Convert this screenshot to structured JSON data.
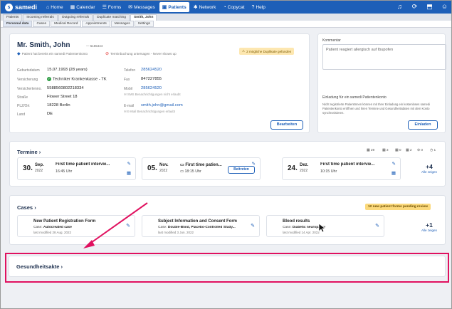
{
  "brand": {
    "name": "samedi"
  },
  "nav": [
    {
      "label": "Home",
      "icon": "home-icon",
      "glyph": "⌂"
    },
    {
      "label": "Calendar",
      "icon": "calendar-icon",
      "glyph": "▦"
    },
    {
      "label": "Forms",
      "icon": "forms-icon",
      "glyph": "☰"
    },
    {
      "label": "Messages",
      "icon": "messages-icon",
      "glyph": "✉"
    },
    {
      "label": "Patients",
      "icon": "patients-icon",
      "glyph": "▣",
      "active": true
    },
    {
      "label": "Network",
      "icon": "network-icon",
      "glyph": "✱"
    },
    {
      "label": "Copycat",
      "icon": "copycat-icon",
      "glyph": "◔"
    },
    {
      "label": "Help",
      "icon": "help-icon",
      "glyph": "?"
    }
  ],
  "top_icons": [
    "bell-icon",
    "refresh-icon",
    "export-icon",
    "user-icon"
  ],
  "tabs_level1": [
    "Patients",
    "Incoming referrals",
    "Outgoing referrals",
    "Duplicate matching",
    "Smith, John"
  ],
  "tabs_level2": [
    "Personal data",
    "Cases",
    "Medical Record",
    "Appointments",
    "Messages",
    "Settings"
  ],
  "patient": {
    "name": "Mr. Smith, John",
    "id": "— 5165444",
    "flag1": "Patient hat bereits ein samedi Patientenkonto",
    "flag2": "Terminbuchung untersagen - Never shows up",
    "duplicates": "2 mögliche Duplikate gefunden",
    "fields_left": [
      {
        "label": "Geburtsdatum",
        "value": "15.07.1993 (28 years)"
      },
      {
        "label": "Versicherung",
        "value": "Techniker Krankenkasse - TK"
      },
      {
        "label": "Versichertenno.",
        "value": "5588560802218334"
      },
      {
        "label": "Straße",
        "value": "Flower Street 18"
      },
      {
        "label": "PLZ/Ort",
        "value": "18228 Berlin"
      },
      {
        "label": "Land",
        "value": "DE"
      }
    ],
    "phone_label": "Telefon",
    "phone": "285624520",
    "fax_label": "Fax",
    "fax": "847227855",
    "mobile_label": "Mobil",
    "mobile": "285624520",
    "sms_note": "SMS Benachrichtigungen nicht erlaubt",
    "email_label": "E-mail",
    "email": "smith.john@gmail.com",
    "email_note": "E-Mail Benachrichtigungen erlaubt",
    "edit_button": "Bearbeiten"
  },
  "comment": {
    "title": "Kommentar",
    "text": "Patient reagiert allergisch auf Ibupofen"
  },
  "invite": {
    "title": "Einladung für ein samedi Patientenkonto",
    "text": "Nicht registrierte PatientInnen können mit Ihrer Einladung ein kostenloses samedi Patientenkonto eröffnen und ihren Termine und Gesundheitsdaten mit dem Konto synchronisieren.",
    "button": "Einladen"
  },
  "termine": {
    "title": "Termine",
    "counts": [
      {
        "icon": "calendar-check-icon",
        "glyph": "▦",
        "value": "29"
      },
      {
        "icon": "calendar-icon",
        "glyph": "▦",
        "value": "3"
      },
      {
        "icon": "calendar-cancel-icon",
        "glyph": "▦",
        "value": "0"
      },
      {
        "icon": "calendar-icon",
        "glyph": "▦",
        "value": "2"
      },
      {
        "icon": "no-show-icon",
        "glyph": "⊘",
        "value": "0"
      },
      {
        "icon": "clock-icon",
        "glyph": "◷",
        "value": "1"
      }
    ],
    "items": [
      {
        "day": "30.",
        "month": "Sep.",
        "year": "2022",
        "title": "First time patient intervie...",
        "time": "16:45 Uhr"
      },
      {
        "day": "05.",
        "month": "Nov.",
        "year": "2022",
        "title": "First time patien...",
        "time": "18:15 Uhr",
        "button": "Beitreten"
      },
      {
        "day": "24.",
        "month": "Dez.",
        "year": "2022",
        "title": "First time patient intervie...",
        "time": "10:15 Uhr"
      }
    ],
    "more_count": "+4",
    "more_label": "Alle zeigen"
  },
  "cases": {
    "title": "Cases",
    "pending": "12 new patient forms pending review",
    "items": [
      {
        "title": "New Patient Registration Form",
        "case_label": "Case:",
        "case": "Autocreated case",
        "modified": "last modified 28 Aug. 2022"
      },
      {
        "title": "Subject Information and Consent Form",
        "case_label": "Case:",
        "case": "Double-Blind, Placebo-Controlled Study...",
        "modified": "last modified 3 Jun. 2022"
      },
      {
        "title": "Blood results",
        "case_label": "Case:",
        "case": "Diabetic neuropathy",
        "modified": "last modified 14 Apr. 2022"
      }
    ],
    "more_count": "+1",
    "more_label": "Alle zeigen"
  },
  "gesundheitsakte": {
    "title": "Gesundheitsakte"
  },
  "colors": {
    "primary": "#1d5fb8",
    "highlight": "#e0115f",
    "warning": "#fde7b0"
  }
}
